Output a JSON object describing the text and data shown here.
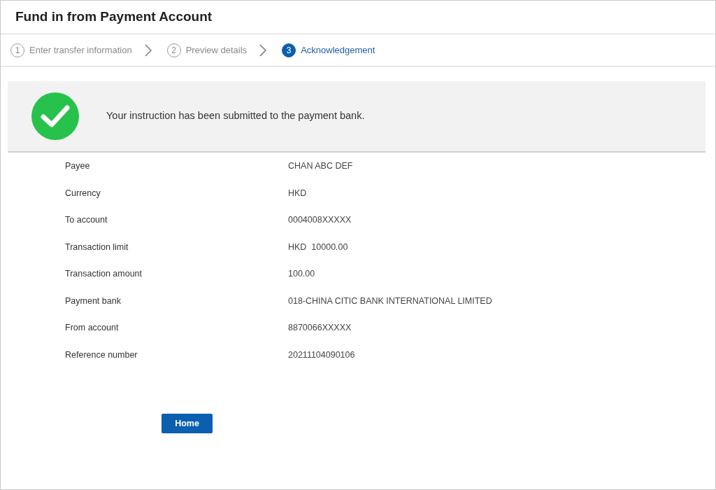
{
  "title": "Fund in from Payment Account",
  "steps": [
    {
      "number": "1",
      "label": "Enter transfer information",
      "selected": false
    },
    {
      "number": "2",
      "label": "Preview details",
      "selected": false
    },
    {
      "number": "3",
      "label": "Acknowledgement",
      "selected": true
    }
  ],
  "message": "Your instruction has been submitted to the payment bank.",
  "details": [
    {
      "label": "Payee",
      "value": "CHAN ABC DEF"
    },
    {
      "label": "Currency",
      "value": "HKD"
    },
    {
      "label": "To account",
      "value": "0004008XXXXX"
    },
    {
      "label": "Transaction limit",
      "value": "HKD  10000.00"
    },
    {
      "label": "Transaction amount",
      "value": "100.00"
    },
    {
      "label": "Payment bank",
      "value": "018-CHINA CITIC BANK INTERNATIONAL LIMITED"
    },
    {
      "label": "From account",
      "value": "8870066XXXXX"
    },
    {
      "label": "Reference number",
      "value": "20211104090106"
    }
  ],
  "button": "Home"
}
